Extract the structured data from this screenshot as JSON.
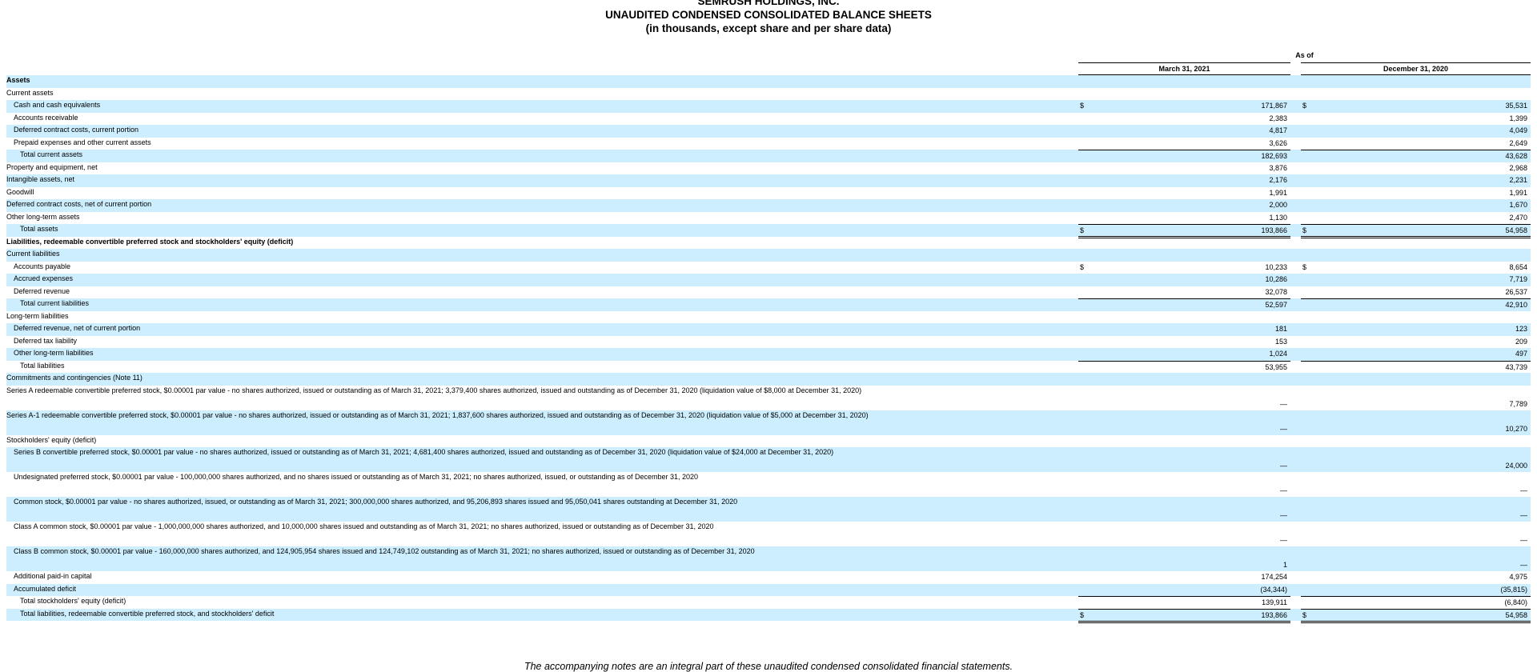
{
  "header": {
    "company": "SEMRUSH HOLDINGS, INC.",
    "title": "UNAUDITED CONDENSED CONSOLIDATED BALANCE SHEETS",
    "units": "(in thousands, except share and per share data)"
  },
  "columns": {
    "as_of": "As of",
    "col1": "March 31, 2021",
    "col2": "December 31, 2020"
  },
  "rows": [
    {
      "label": "Assets",
      "bold": true,
      "indent": 0,
      "v1": "",
      "v2": "",
      "dollar": false,
      "top": false,
      "double": false,
      "tall": false
    },
    {
      "label": "Current assets",
      "bold": false,
      "indent": 0,
      "v1": "",
      "v2": "",
      "dollar": false,
      "top": false,
      "double": false,
      "tall": false
    },
    {
      "label": "Cash and cash equivalents",
      "bold": false,
      "indent": 1,
      "v1": "171,867",
      "v2": "35,531",
      "dollar": true,
      "top": false,
      "double": false,
      "tall": false
    },
    {
      "label": "Accounts receivable",
      "bold": false,
      "indent": 1,
      "v1": "2,383",
      "v2": "1,399",
      "dollar": false,
      "top": false,
      "double": false,
      "tall": false
    },
    {
      "label": "Deferred contract costs, current portion",
      "bold": false,
      "indent": 1,
      "v1": "4,817",
      "v2": "4,049",
      "dollar": false,
      "top": false,
      "double": false,
      "tall": false
    },
    {
      "label": "Prepaid expenses and other current assets",
      "bold": false,
      "indent": 1,
      "v1": "3,626",
      "v2": "2,649",
      "dollar": false,
      "top": false,
      "double": false,
      "tall": false
    },
    {
      "label": "Total current assets",
      "bold": false,
      "indent": 2,
      "v1": "182,693",
      "v2": "43,628",
      "dollar": false,
      "top": true,
      "double": false,
      "tall": false
    },
    {
      "label": "Property and equipment, net",
      "bold": false,
      "indent": 0,
      "v1": "3,876",
      "v2": "2,968",
      "dollar": false,
      "top": false,
      "double": false,
      "tall": false
    },
    {
      "label": "Intangible assets, net",
      "bold": false,
      "indent": 0,
      "v1": "2,176",
      "v2": "2,231",
      "dollar": false,
      "top": false,
      "double": false,
      "tall": false
    },
    {
      "label": "Goodwill",
      "bold": false,
      "indent": 0,
      "v1": "1,991",
      "v2": "1,991",
      "dollar": false,
      "top": false,
      "double": false,
      "tall": false
    },
    {
      "label": "Deferred contract costs, net of current portion",
      "bold": false,
      "indent": 0,
      "v1": "2,000",
      "v2": "1,670",
      "dollar": false,
      "top": false,
      "double": false,
      "tall": false
    },
    {
      "label": "Other long-term assets",
      "bold": false,
      "indent": 0,
      "v1": "1,130",
      "v2": "2,470",
      "dollar": false,
      "top": false,
      "double": false,
      "tall": false
    },
    {
      "label": "Total assets",
      "bold": false,
      "indent": 2,
      "v1": "193,866",
      "v2": "54,958",
      "dollar": true,
      "top": true,
      "double": true,
      "tall": false
    },
    {
      "label": "Liabilities, redeemable convertible preferred stock and stockholders' equity (deficit)",
      "bold": true,
      "indent": 0,
      "v1": "",
      "v2": "",
      "dollar": false,
      "top": false,
      "double": false,
      "tall": false
    },
    {
      "label": "Current liabilities",
      "bold": false,
      "indent": 0,
      "v1": "",
      "v2": "",
      "dollar": false,
      "top": false,
      "double": false,
      "tall": false
    },
    {
      "label": "Accounts payable",
      "bold": false,
      "indent": 1,
      "v1": "10,233",
      "v2": "8,654",
      "dollar": true,
      "top": false,
      "double": false,
      "tall": false
    },
    {
      "label": "Accrued expenses",
      "bold": false,
      "indent": 1,
      "v1": "10,286",
      "v2": "7,719",
      "dollar": false,
      "top": false,
      "double": false,
      "tall": false
    },
    {
      "label": "Deferred revenue",
      "bold": false,
      "indent": 1,
      "v1": "32,078",
      "v2": "26,537",
      "dollar": false,
      "top": false,
      "double": false,
      "tall": false
    },
    {
      "label": "Total current liabilities",
      "bold": false,
      "indent": 2,
      "v1": "52,597",
      "v2": "42,910",
      "dollar": false,
      "top": true,
      "double": false,
      "tall": false
    },
    {
      "label": "Long-term liabilities",
      "bold": false,
      "indent": 0,
      "v1": "",
      "v2": "",
      "dollar": false,
      "top": false,
      "double": false,
      "tall": false
    },
    {
      "label": "Deferred revenue, net of current portion",
      "bold": false,
      "indent": 1,
      "v1": "181",
      "v2": "123",
      "dollar": false,
      "top": false,
      "double": false,
      "tall": false
    },
    {
      "label": "Deferred tax liability",
      "bold": false,
      "indent": 1,
      "v1": "153",
      "v2": "209",
      "dollar": false,
      "top": false,
      "double": false,
      "tall": false
    },
    {
      "label": "Other long-term liabilities",
      "bold": false,
      "indent": 1,
      "v1": "1,024",
      "v2": "497",
      "dollar": false,
      "top": false,
      "double": false,
      "tall": false
    },
    {
      "label": "Total liabilities",
      "bold": false,
      "indent": 2,
      "v1": "53,955",
      "v2": "43,739",
      "dollar": false,
      "top": true,
      "double": false,
      "tall": false
    },
    {
      "label": "Commitments and contingencies (Note 11)",
      "bold": false,
      "indent": 0,
      "v1": "",
      "v2": "",
      "dollar": false,
      "top": false,
      "double": false,
      "tall": false
    },
    {
      "label": "Series A redeemable convertible preferred stock, $0.00001 par value - no shares authorized, issued or outstanding as of March 31, 2021; 3,379,400 shares authorized, issued and outstanding as of December 31, 2020 (liquidation value of $8,000 at December 31, 2020)",
      "bold": false,
      "indent": 0,
      "v1": "—",
      "v2": "7,789",
      "dollar": false,
      "top": false,
      "double": false,
      "tall": true
    },
    {
      "label": "Series A-1 redeemable convertible preferred stock, $0.00001 par value - no shares authorized, issued or outstanding as of March 31, 2021; 1,837,600 shares authorized, issued and outstanding as of December 31, 2020 (liquidation value of $5,000 at December 31, 2020)",
      "bold": false,
      "indent": 0,
      "v1": "—",
      "v2": "10,270",
      "dollar": false,
      "top": false,
      "double": false,
      "tall": true
    },
    {
      "label": "Stockholders' equity (deficit)",
      "bold": false,
      "indent": 0,
      "v1": "",
      "v2": "",
      "dollar": false,
      "top": false,
      "double": false,
      "tall": false
    },
    {
      "label": "Series B convertible preferred stock, $0.00001 par value - no shares authorized, issued or outstanding as of March 31, 2021; 4,681,400 shares authorized, issued and outstanding as of December 31, 2020 (liquidation value of $24,000 at December 31, 2020)",
      "bold": false,
      "indent": 1,
      "v1": "—",
      "v2": "24,000",
      "dollar": false,
      "top": false,
      "double": false,
      "tall": true
    },
    {
      "label": "Undesignated preferred stock, $0.00001 par value - 100,000,000 shares authorized, and no shares issued or outstanding as of March 31, 2021; no shares authorized, issued, or outstanding as of December 31, 2020",
      "bold": false,
      "indent": 1,
      "v1": "—",
      "v2": "—",
      "dollar": false,
      "top": false,
      "double": false,
      "tall": true
    },
    {
      "label": "Common stock, $0.00001 par value - no shares authorized, issued, or outstanding as of March 31, 2021; 300,000,000 shares authorized, and 95,206,893 shares issued and 95,050,041 shares outstanding at December 31, 2020",
      "bold": false,
      "indent": 1,
      "v1": "—",
      "v2": "—",
      "dollar": false,
      "top": false,
      "double": false,
      "tall": true
    },
    {
      "label": "Class A common stock, $0.00001 par value - 1,000,000,000 shares authorized, and 10,000,000 shares issued and outstanding as of March 31, 2021; no shares authorized, issued or outstanding as of December 31, 2020",
      "bold": false,
      "indent": 1,
      "v1": "—",
      "v2": "—",
      "dollar": false,
      "top": false,
      "double": false,
      "tall": true
    },
    {
      "label": "Class B common stock, $0.00001 par value - 160,000,000 shares authorized, and 124,905,954 shares issued and 124,749,102 outstanding as of March 31, 2021; no shares authorized, issued or outstanding as of December 31, 2020",
      "bold": false,
      "indent": 1,
      "v1": "1",
      "v2": "—",
      "dollar": false,
      "top": false,
      "double": false,
      "tall": true
    },
    {
      "label": "Additional paid-in capital",
      "bold": false,
      "indent": 1,
      "v1": "174,254",
      "v2": "4,975",
      "dollar": false,
      "top": false,
      "double": false,
      "tall": false
    },
    {
      "label": "Accumulated deficit",
      "bold": false,
      "indent": 1,
      "v1": "(34,344)",
      "v2": "(35,815)",
      "dollar": false,
      "top": false,
      "double": false,
      "tall": false
    },
    {
      "label": "Total stockholders' equity (deficit)",
      "bold": false,
      "indent": 2,
      "v1": "139,911",
      "v2": "(6,840)",
      "dollar": false,
      "top": true,
      "double": false,
      "tall": false
    },
    {
      "label": "Total liabilities, redeemable convertible preferred stock, and stockholders' deficit",
      "bold": false,
      "indent": 2,
      "v1": "193,866",
      "v2": "54,958",
      "dollar": true,
      "top": true,
      "double": true,
      "tall": false
    }
  ],
  "dollar_sign": "$",
  "footer": "The accompanying notes are an integral part of these unaudited condensed consolidated financial statements.",
  "colors": {
    "row_shade": "#cceeff"
  }
}
